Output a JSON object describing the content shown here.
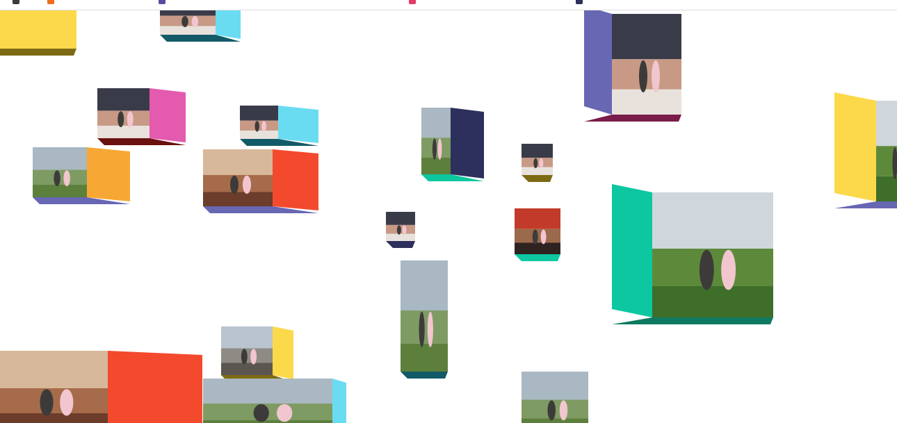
{
  "palette": {
    "yellow": "#fcd94a",
    "dark_yellow": "#7d6a14",
    "pink": "#e45aae",
    "dark_red": "#6b1110",
    "red": "#f34a2e",
    "orange": "#f7a834",
    "light_blue": "#6adcf2",
    "dark_teal": "#135a68",
    "teal": "#0cc7a0",
    "dark_green_teal": "#0f7a62",
    "purple": "#6767b3",
    "navy": "#2d2f5c",
    "olive": "#5a7a1e",
    "maroon": "#7a1c4a",
    "black": "#141414"
  },
  "photo_tones": {
    "mountain": [
      "#a9b8c2",
      "#7f9b64",
      "#5d7f3c"
    ],
    "indoor": [
      "#d8b89a",
      "#a66b4a",
      "#6c3d2a"
    ],
    "selfie": [
      "#3a3b49",
      "#c89a86",
      "#e9e2dc"
    ],
    "gallery": [
      "#c23b2a",
      "#9b6a4c",
      "#2e2320"
    ],
    "tea_field": [
      "#cfd6dc",
      "#5d8a3a",
      "#3e6e2a"
    ],
    "street": [
      "#b9c4cf",
      "#8e8a84",
      "#5b5650"
    ]
  },
  "topbar_icons": [
    {
      "name": "app-icon",
      "color": "#3b3b3b"
    },
    {
      "name": "orange-app-icon",
      "color": "#f06b1c"
    },
    {
      "name": "purple-app-icon",
      "color": "#5a4aa0"
    },
    {
      "name": "pink-app-icon",
      "color": "#e63a6a"
    },
    {
      "name": "dark-app-icon",
      "color": "#2f2f5a"
    }
  ],
  "cubes": [
    {
      "id": "cube-top-left-yellow",
      "front_color": "yellow",
      "bottom_color": "dark_yellow",
      "photo": null
    },
    {
      "id": "cube-top-teal",
      "front_color": "light_blue",
      "bottom_color": "dark_teal",
      "photo": "selfie"
    },
    {
      "id": "cube-selfie-pink",
      "front_color": "pink",
      "bottom_color": "dark_red",
      "photo": "selfie"
    },
    {
      "id": "cube-lake-orange",
      "front_color": "orange",
      "bottom_color": "purple",
      "photo": "mountain"
    },
    {
      "id": "cube-car-selfie",
      "front_color": "light_blue",
      "bottom_color": "dark_teal",
      "photo": "selfie"
    },
    {
      "id": "cube-indoor-red",
      "front_color": "red",
      "bottom_color": "purple",
      "photo": "indoor"
    },
    {
      "id": "cube-field-upper",
      "front_color": "navy",
      "bottom_color": "teal",
      "photo": "mountain"
    },
    {
      "id": "cube-kid-yellow",
      "front_color": "yellow",
      "bottom_color": "dark_yellow",
      "photo": "selfie"
    },
    {
      "id": "cube-night-selfie",
      "front_color": "purple",
      "bottom_color": "navy",
      "photo": "selfie"
    },
    {
      "id": "cube-gallery",
      "front_color": "yellow",
      "bottom_color": "teal",
      "photo": "gallery"
    },
    {
      "id": "cube-tea-field-large",
      "front_color": "teal",
      "bottom_color": "dark_green_teal",
      "photo": "tea_field"
    },
    {
      "id": "cube-mountain-stack",
      "front_color": "teal",
      "bottom_color": "dark_teal",
      "photo": "mountain"
    },
    {
      "id": "cube-street",
      "front_color": "yellow",
      "bottom_color": "dark_yellow",
      "photo": "street"
    },
    {
      "id": "cube-bottom-left-large",
      "front_color": "red",
      "bottom_color": "dark_red",
      "photo": "indoor"
    },
    {
      "id": "cube-forest-path",
      "front_color": "light_blue",
      "bottom_color": "dark_teal",
      "photo": "mountain"
    },
    {
      "id": "cube-right-pair",
      "front_color": "yellow",
      "bottom_color": "purple",
      "photo": "tea_field"
    },
    {
      "id": "cube-top-right-cluster",
      "front_color": "purple",
      "bottom_color": "maroon",
      "photo": "selfie"
    },
    {
      "id": "cube-bottom-center",
      "front_color": "teal",
      "bottom_color": "olive",
      "photo": "mountain"
    }
  ]
}
